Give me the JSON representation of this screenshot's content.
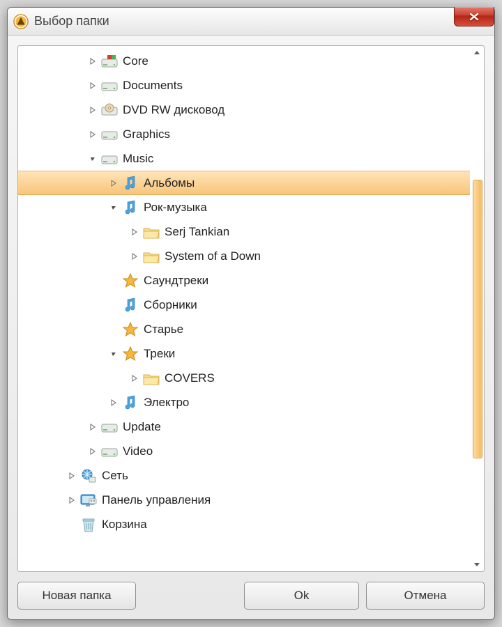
{
  "window": {
    "title": "Выбор папки"
  },
  "buttons": {
    "new_folder": "Новая папка",
    "ok": "Ok",
    "cancel": "Отмена"
  },
  "tree": [
    {
      "depth": 1,
      "expander": "closed",
      "icon": "drive-win",
      "label": "Core"
    },
    {
      "depth": 1,
      "expander": "closed",
      "icon": "drive",
      "label": "Documents"
    },
    {
      "depth": 1,
      "expander": "closed",
      "icon": "dvd",
      "label": "DVD RW дисковод"
    },
    {
      "depth": 1,
      "expander": "closed",
      "icon": "drive",
      "label": "Graphics"
    },
    {
      "depth": 1,
      "expander": "open",
      "icon": "drive",
      "label": "Music"
    },
    {
      "depth": 2,
      "expander": "closed",
      "icon": "music",
      "label": "Альбомы",
      "selected": true
    },
    {
      "depth": 2,
      "expander": "open",
      "icon": "music",
      "label": "Рок-музыка"
    },
    {
      "depth": 3,
      "expander": "closed",
      "icon": "folder",
      "label": "Serj Tankian"
    },
    {
      "depth": 3,
      "expander": "closed",
      "icon": "folder",
      "label": "System of a Down"
    },
    {
      "depth": 2,
      "expander": "none",
      "icon": "star",
      "label": "Саундтреки"
    },
    {
      "depth": 2,
      "expander": "none",
      "icon": "music",
      "label": "Сборники"
    },
    {
      "depth": 2,
      "expander": "none",
      "icon": "star",
      "label": "Старье"
    },
    {
      "depth": 2,
      "expander": "open",
      "icon": "star",
      "label": "Треки"
    },
    {
      "depth": 3,
      "expander": "closed",
      "icon": "folder",
      "label": "COVERS"
    },
    {
      "depth": 2,
      "expander": "closed",
      "icon": "music",
      "label": "Электро"
    },
    {
      "depth": 1,
      "expander": "closed",
      "icon": "drive",
      "label": "Update"
    },
    {
      "depth": 1,
      "expander": "closed",
      "icon": "drive",
      "label": "Video"
    },
    {
      "depth": 0,
      "expander": "closed",
      "icon": "network",
      "label": "Сеть"
    },
    {
      "depth": 0,
      "expander": "closed",
      "icon": "cpanel",
      "label": "Панель управления"
    },
    {
      "depth": 0,
      "expander": "none",
      "icon": "recycle",
      "label": "Корзина"
    }
  ]
}
